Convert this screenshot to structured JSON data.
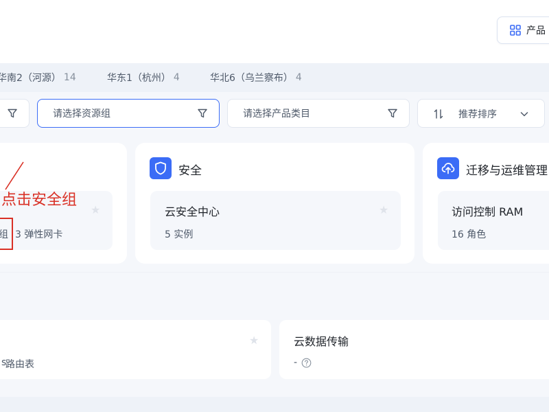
{
  "header": {
    "products_button": {
      "label": "产品",
      "icon": "grid-icon"
    }
  },
  "regions": [
    {
      "label": "华南2（河源）",
      "count": "14"
    },
    {
      "label": "华东1（杭州）",
      "count": "4"
    },
    {
      "label": "华北6（乌兰察布）",
      "count": "4"
    }
  ],
  "filters": {
    "resource_group": {
      "placeholder": "请选择资源组"
    },
    "product_category": {
      "placeholder": "请选择产品类目"
    },
    "sort": {
      "label": "推荐排序"
    }
  },
  "cards": [
    {
      "item": {
        "stat_tail": "组",
        "stat": "3 弹性网卡"
      },
      "annotation": "点击安全组"
    },
    {
      "title": "安全",
      "item": {
        "name": "云安全中心",
        "stat": "5 实例"
      }
    },
    {
      "title": "迁移与运维管理",
      "item": {
        "name": "访问控制 RAM",
        "stat": "16 角色"
      }
    }
  ],
  "bottom_row": [
    {
      "stat": "路由表"
    },
    {
      "name": "云数据传输",
      "stat": "-"
    }
  ],
  "colors": {
    "accent": "#3b6cf6",
    "annotation": "#d93025",
    "page_bg": "#f5f7fb"
  }
}
